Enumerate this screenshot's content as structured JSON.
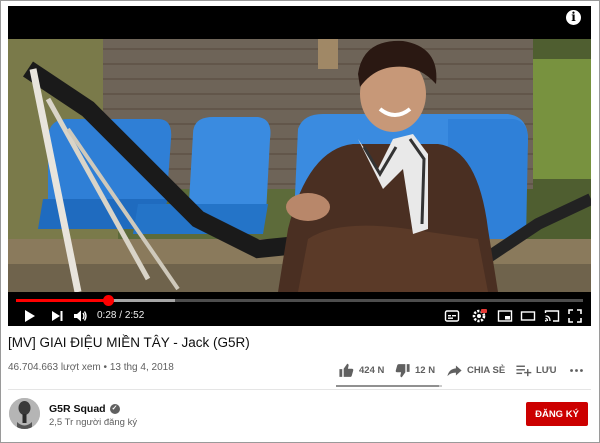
{
  "player": {
    "current_time": "0:28",
    "duration": "2:52",
    "progress_fraction": 0.163,
    "buffered_fraction": 0.28,
    "progress_color": "#ff0000"
  },
  "video": {
    "title": "[MV] GIAI ĐIỆU MIỀN TÂY - Jack (G5R)",
    "views": "46.704.663 lượt xem",
    "date": "13 thg 4, 2018"
  },
  "actions": {
    "like_count": "424 N",
    "dislike_count": "12 N",
    "share_label": "CHIA SẺ",
    "save_label": "LƯU",
    "like_ratio": 0.97,
    "icons": [
      "thumbs-up-icon",
      "thumbs-down-icon",
      "share-icon",
      "add-to-playlist-icon",
      "more-icon"
    ]
  },
  "channel": {
    "name": "G5R Squad",
    "subscribers": "2,5 Tr người đăng ký",
    "subscribe_label": "ĐĂNG KÝ",
    "subscribe_color": "#cc0000"
  },
  "player_controls": {
    "icons": [
      "play-icon",
      "next-icon",
      "volume-icon",
      "subtitles-icon",
      "settings-icon",
      "miniplayer-icon",
      "theater-mode-icon",
      "cast-icon",
      "fullscreen-icon"
    ]
  }
}
